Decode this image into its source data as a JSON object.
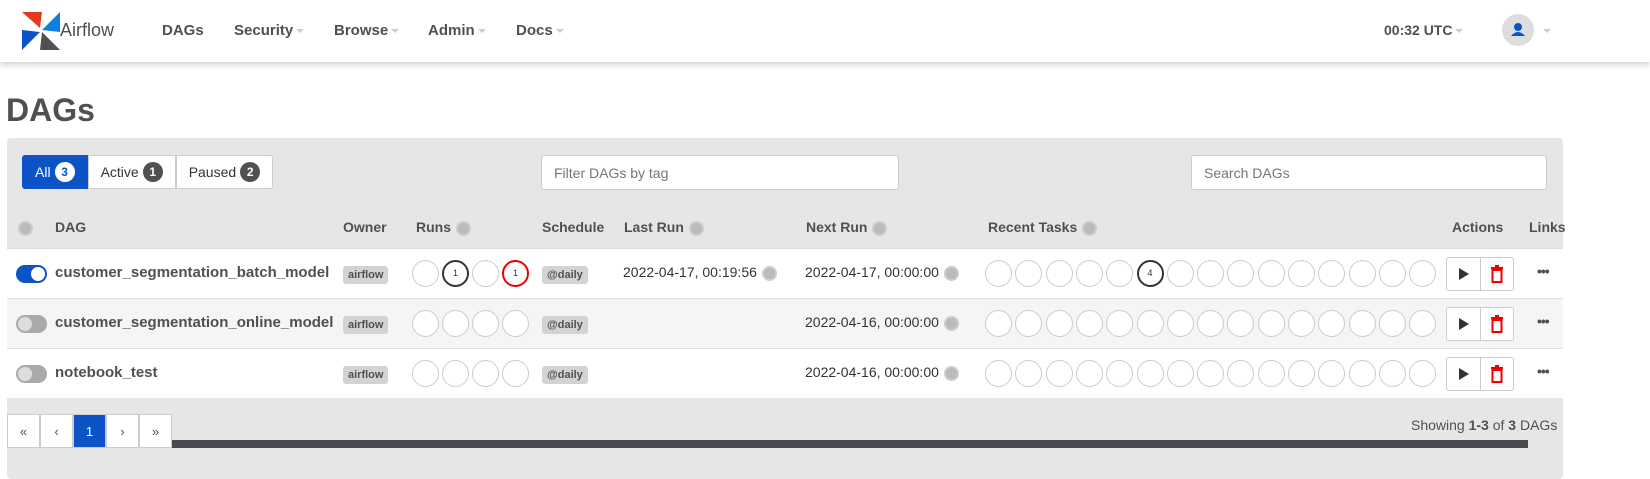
{
  "nav": {
    "brand": "Airflow",
    "items": [
      {
        "label": "DAGs",
        "caret": false
      },
      {
        "label": "Security",
        "caret": true
      },
      {
        "label": "Browse",
        "caret": true
      },
      {
        "label": "Admin",
        "caret": true
      },
      {
        "label": "Docs",
        "caret": true
      }
    ],
    "time": "00:32 UTC"
  },
  "page": {
    "title": "DAGs"
  },
  "filters": {
    "all": "All",
    "all_count": "3",
    "active": "Active",
    "active_count": "1",
    "paused": "Paused",
    "paused_count": "2"
  },
  "tag_filter": {
    "placeholder": "Filter DAGs by tag"
  },
  "search": {
    "placeholder": "Search DAGs"
  },
  "columns": {
    "dag": "DAG",
    "owner": "Owner",
    "runs": "Runs",
    "schedule": "Schedule",
    "last_run": "Last Run",
    "next_run": "Next Run",
    "recent_tasks": "Recent Tasks",
    "actions": "Actions",
    "links": "Links"
  },
  "rows": [
    {
      "name": "customer_segmentation_batch_model",
      "active": true,
      "owner": "airflow",
      "runs": [
        "",
        "1",
        "",
        "1"
      ],
      "runs_style": [
        "",
        "dark",
        "",
        "red"
      ],
      "schedule": "@daily",
      "last_run": "2022-04-17, 00:19:56",
      "next_run": "2022-04-17, 00:00:00",
      "recent_tasks": [
        "",
        "",
        "",
        "",
        "",
        "4",
        "",
        "",
        "",
        "",
        "",
        "",
        "",
        "",
        ""
      ]
    },
    {
      "name": "customer_segmentation_online_model",
      "active": false,
      "owner": "airflow",
      "runs": [
        "",
        "",
        "",
        ""
      ],
      "runs_style": [
        "",
        "",
        "",
        ""
      ],
      "schedule": "@daily",
      "last_run": "",
      "next_run": "2022-04-16, 00:00:00",
      "recent_tasks": [
        "",
        "",
        "",
        "",
        "",
        "",
        "",
        "",
        "",
        "",
        "",
        "",
        "",
        "",
        ""
      ]
    },
    {
      "name": "notebook_test",
      "active": false,
      "owner": "airflow",
      "runs": [
        "",
        "",
        "",
        ""
      ],
      "runs_style": [
        "",
        "",
        "",
        ""
      ],
      "schedule": "@daily",
      "last_run": "",
      "next_run": "2022-04-16, 00:00:00",
      "recent_tasks": [
        "",
        "",
        "",
        "",
        "",
        "",
        "",
        "",
        "",
        "",
        "",
        "",
        "",
        "",
        ""
      ]
    }
  ],
  "pagination": {
    "first": "«",
    "prev": "‹",
    "current": "1",
    "next": "›",
    "last": "»"
  },
  "showing": {
    "prefix": "Showing ",
    "range": "1-3",
    "of": " of ",
    "total": "3",
    "suffix": " DAGs"
  },
  "colors": {
    "primary": "#0b53c7",
    "failed": "#e00000",
    "text": "#51504f"
  }
}
